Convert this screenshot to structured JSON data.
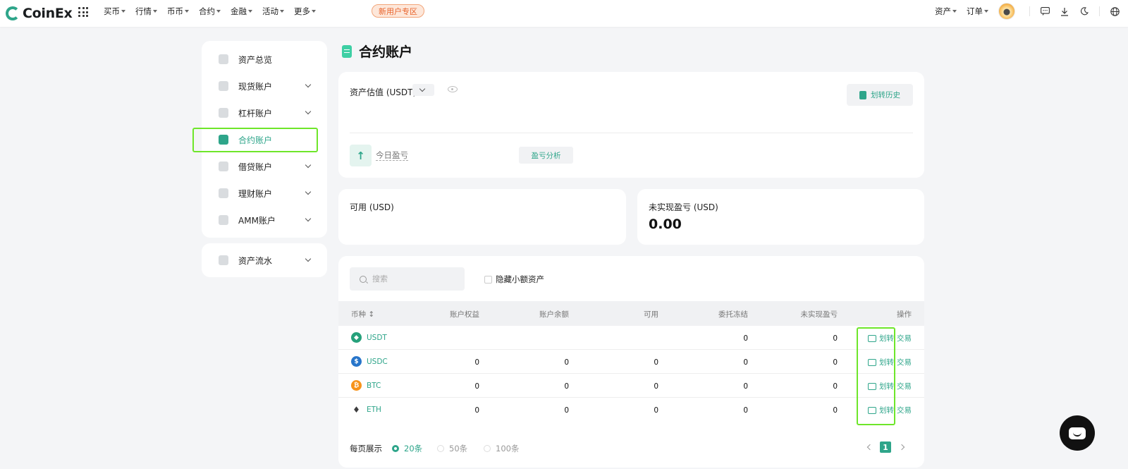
{
  "brand": {
    "name": "CoinEx",
    "accent": "#2ea58a",
    "highlight": "#6ee62a"
  },
  "nav": {
    "items": [
      {
        "label": "买币"
      },
      {
        "label": "行情"
      },
      {
        "label": "币币"
      },
      {
        "label": "合约"
      },
      {
        "label": "金融"
      },
      {
        "label": "活动"
      },
      {
        "label": "更多"
      }
    ],
    "promo": "新用户专区"
  },
  "topright": {
    "assets": "资产",
    "orders": "订单",
    "icons": [
      "avatar",
      "chat-icon",
      "download-icon",
      "moon-icon",
      "globe-icon"
    ]
  },
  "sidebar": {
    "items": [
      {
        "label": "资产总览",
        "icon": "overview-icon",
        "expandable": false
      },
      {
        "label": "现货账户",
        "icon": "spot-icon",
        "expandable": true
      },
      {
        "label": "杠杆账户",
        "icon": "margin-icon",
        "expandable": true
      },
      {
        "label": "合约账户",
        "icon": "futures-icon",
        "expandable": false,
        "active": true
      },
      {
        "label": "借贷账户",
        "icon": "loan-icon",
        "expandable": true
      },
      {
        "label": "理财账户",
        "icon": "finance-icon",
        "expandable": true
      },
      {
        "label": "AMM账户",
        "icon": "amm-icon",
        "expandable": true
      }
    ],
    "history": {
      "label": "资产流水",
      "icon": "history-icon"
    }
  },
  "page": {
    "title": "合约账户"
  },
  "estimate": {
    "label": "资产估值 (USDT)",
    "history_button": "划转历史",
    "pnl_label": "今日盈亏",
    "pnl_button": "盈亏分析"
  },
  "metrics": {
    "available_label": "可用 (USD)",
    "unrealized_label": "未实现盈亏 (USD)",
    "unrealized_value": "0.00"
  },
  "table": {
    "search_placeholder": "搜索",
    "hide_small": "隐藏小额资产",
    "headers": [
      "币种",
      "账户权益",
      "账户余额",
      "可用",
      "委托冻结",
      "未实现盈亏",
      "操作"
    ],
    "rows": [
      {
        "coin": "USDT",
        "equity": "",
        "balance": "",
        "available": "",
        "frozen": "0",
        "unrealized": "0",
        "icon_color": "#26a17b"
      },
      {
        "coin": "USDC",
        "equity": "0",
        "balance": "0",
        "available": "0",
        "frozen": "0",
        "unrealized": "0",
        "icon_color": "#2775ca"
      },
      {
        "coin": "BTC",
        "equity": "0",
        "balance": "0",
        "available": "0",
        "frozen": "0",
        "unrealized": "0",
        "icon_color": "#f7931a"
      },
      {
        "coin": "ETH",
        "equity": "0",
        "balance": "0",
        "available": "0",
        "frozen": "0",
        "unrealized": "0",
        "icon_color": "#3c3c3d"
      }
    ],
    "ops": {
      "transfer": "划转",
      "trade": "交易"
    }
  },
  "pagination": {
    "per_page_label": "每页展示",
    "options": [
      "20条",
      "50条",
      "100条"
    ],
    "selected": "20条",
    "current_page": "1"
  }
}
